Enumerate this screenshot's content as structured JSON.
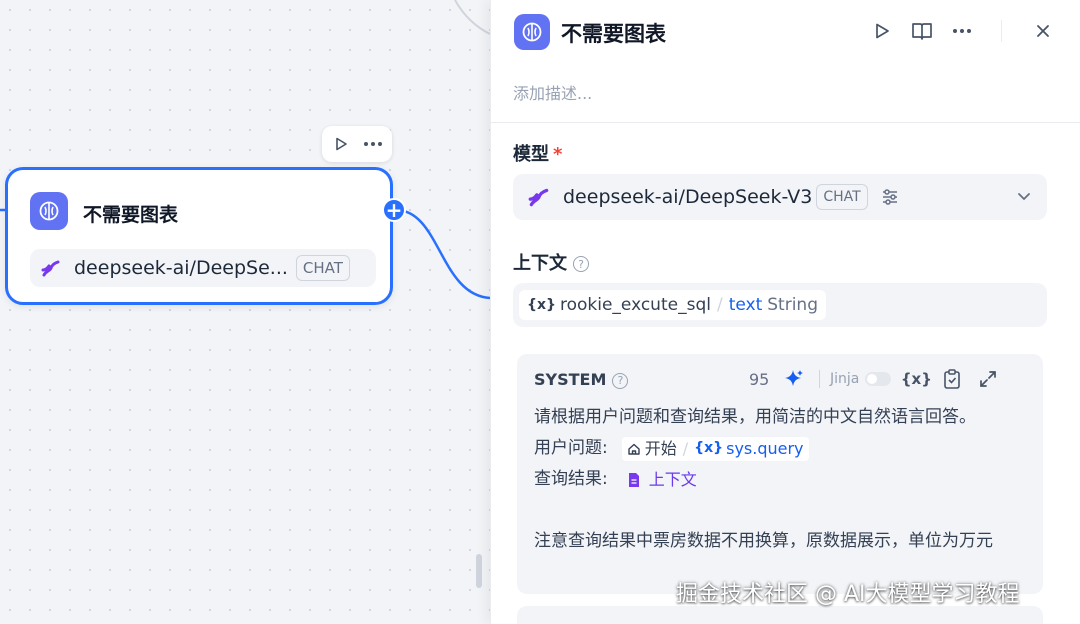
{
  "node": {
    "title": "不需要图表",
    "model_name": "deepseek-ai/DeepSe...",
    "model_badge": "CHAT"
  },
  "panel": {
    "title": "不需要图表",
    "description_placeholder": "添加描述...",
    "model_label": "模型",
    "required_mark": "*",
    "model_name": "deepseek-ai/DeepSeek-V3",
    "model_badge": "CHAT",
    "context_label": "上下文",
    "context_var": {
      "node": "rookie_excute_sql",
      "field": "text",
      "type": "String"
    },
    "system": {
      "label": "SYSTEM",
      "char_count": "95",
      "jinja_label": "Jinja",
      "line1": "请根据用户问题和查询结果，用简洁的中文自然语言回答。",
      "q_label": "用户问题:",
      "q_node": "开始",
      "q_var": "sys.query",
      "r_label": "查询结果:",
      "r_var": "上下文",
      "note": "注意查询结果中票房数据不用换算，原数据展示，单位为万元"
    }
  },
  "watermark": "掘金技术社区 @ AI大模型学习教程",
  "colors": {
    "accent": "#2970ff",
    "icon_bg": "#6172f3",
    "deepseek": "#7839ee"
  }
}
